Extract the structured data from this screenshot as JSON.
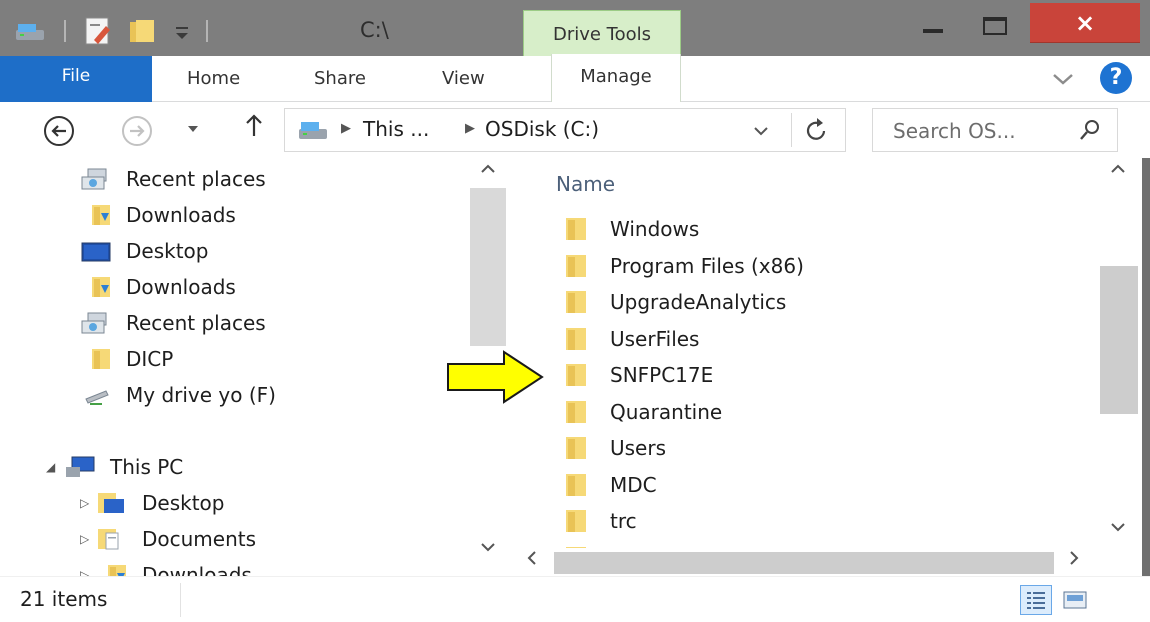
{
  "window": {
    "title": "C:\\",
    "context_tab": "Drive Tools",
    "close_label": "×"
  },
  "ribbon": {
    "tabs": [
      "File",
      "Home",
      "Share",
      "View",
      "Manage"
    ],
    "help_label": "?"
  },
  "address": {
    "crumbs": [
      "This ...",
      "OSDisk (C:)"
    ],
    "search_placeholder": "Search OS..."
  },
  "nav_pane": {
    "quick_access": [
      {
        "label": "Recent places",
        "icon": "recent-places-icon"
      },
      {
        "label": "Downloads",
        "icon": "downloads-folder-icon"
      },
      {
        "label": "Desktop",
        "icon": "desktop-icon"
      },
      {
        "label": "Downloads",
        "icon": "downloads-folder-icon"
      },
      {
        "label": "Recent places",
        "icon": "recent-places-icon"
      },
      {
        "label": "DICP",
        "icon": "folder-icon"
      },
      {
        "label": "My drive yo (F)",
        "icon": "network-drive-icon"
      }
    ],
    "this_pc": {
      "label": "This PC",
      "children": [
        {
          "label": "Desktop",
          "icon": "desktop-folder-icon"
        },
        {
          "label": "Documents",
          "icon": "documents-folder-icon"
        },
        {
          "label": "Downloads",
          "icon": "downloads-folder-icon"
        }
      ]
    }
  },
  "content": {
    "column_header": "Name",
    "files": [
      "Windows",
      "Program Files (x86)",
      "UpgradeAnalytics",
      "UserFiles",
      "SNFPC17E",
      "Quarantine",
      "Users",
      "MDC",
      "trc"
    ],
    "highlighted_file": "SNFPC17E"
  },
  "status": {
    "item_count": "21 items"
  },
  "colors": {
    "file_tab": "#1e6ec8",
    "close_button": "#c9443a",
    "drive_tools_tab": "#d7eec9",
    "annotation_arrow": "#ffff00",
    "folder": "#f6d977"
  }
}
